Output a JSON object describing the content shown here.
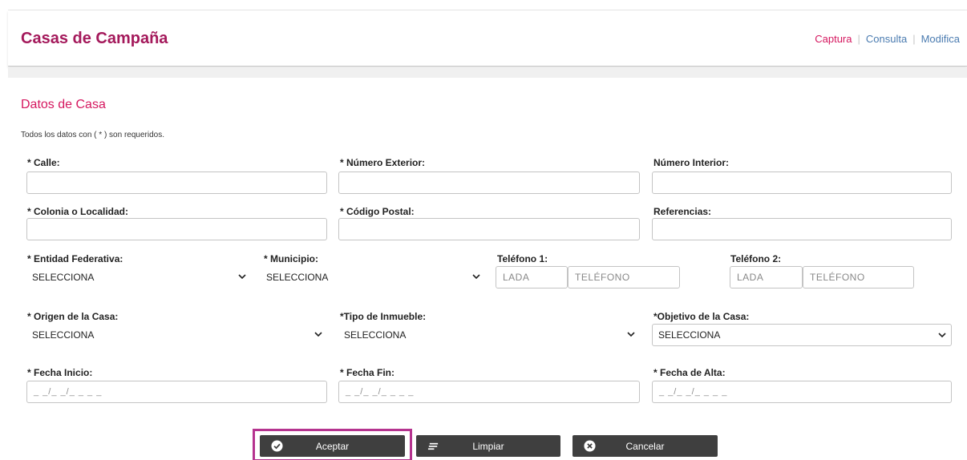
{
  "header": {
    "title": "Casas de Campaña",
    "nav": [
      {
        "label": "Captura"
      },
      {
        "label": "Consulta"
      },
      {
        "label": "Modifica"
      }
    ],
    "separator": "|"
  },
  "section": {
    "title": "Datos de Casa",
    "note": "Todos los datos con ( * ) son requeridos."
  },
  "fields": {
    "calle": {
      "label": "* Calle:",
      "value": ""
    },
    "numero_exterior": {
      "label": "* Número Exterior:",
      "value": ""
    },
    "numero_interior": {
      "label": "Número Interior:",
      "value": ""
    },
    "colonia": {
      "label": "* Colonia o Localidad:",
      "value": ""
    },
    "codigo_postal": {
      "label": "* Código Postal:",
      "value": ""
    },
    "referencias": {
      "label": "Referencias:",
      "value": ""
    },
    "entidad": {
      "label": "* Entidad Federativa:",
      "selected": "SELECCIONA"
    },
    "municipio": {
      "label": "* Municipio:",
      "selected": "SELECCIONA"
    },
    "telefono1": {
      "label": "Teléfono 1:",
      "lada_placeholder": "LADA",
      "numero_placeholder": "TELÉFONO"
    },
    "telefono2": {
      "label": "Teléfono 2:",
      "lada_placeholder": "LADA",
      "numero_placeholder": "TELÉFONO"
    },
    "origen": {
      "label": "* Origen de la Casa:",
      "selected": "SELECCIONA"
    },
    "tipo_inmueble": {
      "label": "*Tipo de Inmueble:",
      "selected": "SELECCIONA"
    },
    "objetivo": {
      "label": "*Objetivo de la Casa:",
      "selected": "SELECCIONA"
    },
    "fecha_inicio": {
      "label": "* Fecha Inicio:",
      "mask": "_ _/_ _/_ _ _ _"
    },
    "fecha_fin": {
      "label": "* Fecha Fin:",
      "mask": "_ _/_ _/_ _ _ _"
    },
    "fecha_alta": {
      "label": "* Fecha de Alta:",
      "mask": "_ _/_ _/_ _ _ _"
    }
  },
  "buttons": {
    "aceptar": {
      "label": "Aceptar",
      "icon": "check-circle-icon"
    },
    "limpiar": {
      "label": "Limpiar",
      "icon": "lines-icon"
    },
    "cancelar": {
      "label": "Cancelar",
      "icon": "x-circle-icon"
    }
  },
  "colors": {
    "brand": "#a4195b",
    "accent": "#d5175f",
    "link": "#4a7bb0",
    "button": "#3f3f3f",
    "highlight": "#b5338f"
  }
}
